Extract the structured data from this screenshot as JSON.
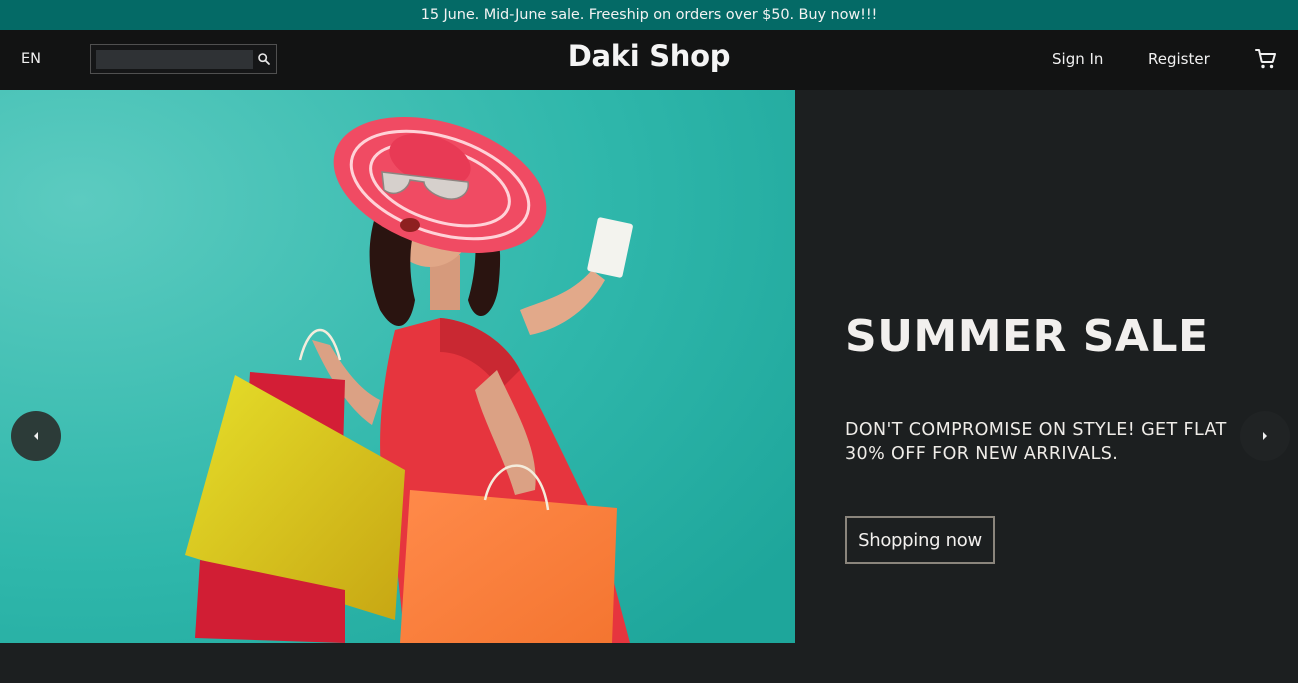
{
  "announcement": {
    "text": "15 June. Mid-June sale. Freeship on orders over $50. Buy now!!!"
  },
  "header": {
    "language": "EN",
    "search": {
      "placeholder": "",
      "value": "",
      "icon": "search-icon"
    },
    "brand": "Daki Shop",
    "sign_in": "Sign In",
    "register": "Register",
    "cart_icon": "cart-icon"
  },
  "hero": {
    "image_icon": "hero-photo",
    "title": "SUMMER SALE",
    "subtitle": "DON'T COMPROMISE ON STYLE! GET FLAT 30% OFF FOR NEW ARRIVALS.",
    "cta": "Shopping now",
    "prev_icon": "chevron-left-icon",
    "next_icon": "chevron-right-icon"
  },
  "colors": {
    "announcement_bg": "#046a66",
    "nav_bg": "#121313",
    "page_bg": "#1c1f20",
    "hero_image_bg": "#2cb4a8"
  }
}
